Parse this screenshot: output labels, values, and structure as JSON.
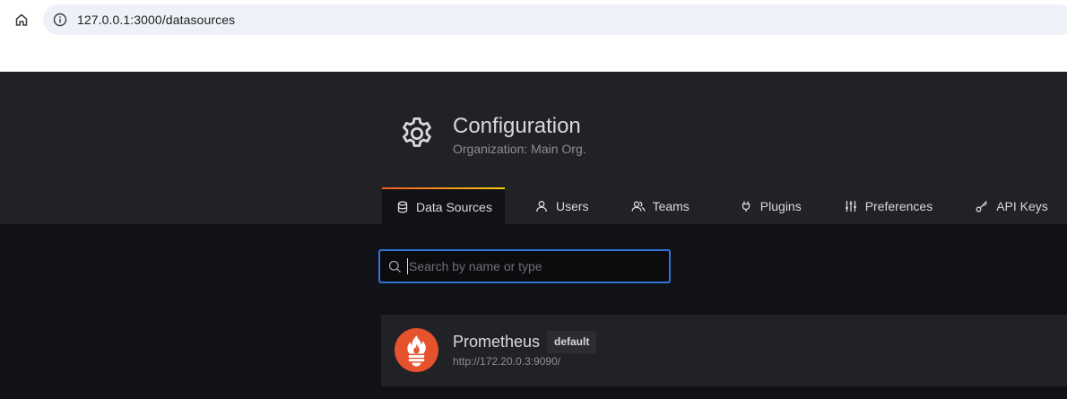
{
  "browser": {
    "url": "127.0.0.1:3000/datasources",
    "home_icon": "home-icon",
    "info_icon": "info-icon"
  },
  "header": {
    "title": "Configuration",
    "subtitle": "Organization: Main Org.",
    "icon": "gear-icon"
  },
  "tabs": [
    {
      "label": "Data Sources",
      "icon": "database-icon",
      "active": true
    },
    {
      "label": "Users",
      "icon": "user-icon",
      "active": false
    },
    {
      "label": "Teams",
      "icon": "users-icon",
      "active": false
    },
    {
      "label": "Plugins",
      "icon": "plug-icon",
      "active": false
    },
    {
      "label": "Preferences",
      "icon": "sliders-icon",
      "active": false
    },
    {
      "label": "API Keys",
      "icon": "key-icon",
      "active": false
    }
  ],
  "search": {
    "placeholder": "Search by name or type",
    "value": ""
  },
  "datasources": [
    {
      "name": "Prometheus",
      "badge": "default",
      "url": "http://172.20.0.3:9090/",
      "logo": "prometheus-logo"
    }
  ],
  "colors": {
    "accent": "#3274d9",
    "tab_gradient_start": "#f05a28",
    "tab_gradient_end": "#fbca0a",
    "prometheus": "#e6522c"
  }
}
